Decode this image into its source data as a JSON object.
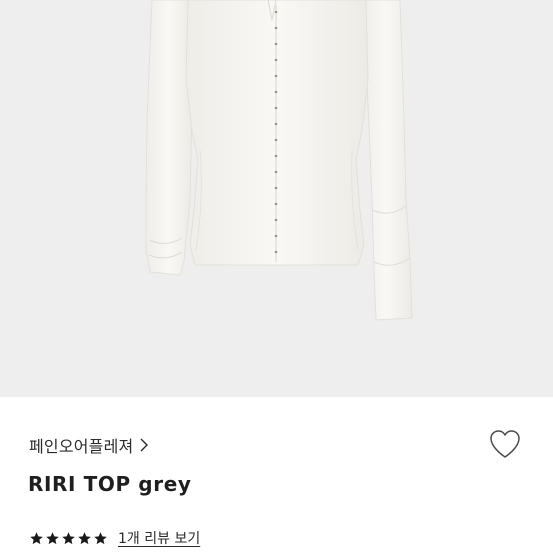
{
  "product": {
    "image_name": "product-image",
    "brand_label": "페인오어플레져",
    "title": "RIRI TOP grey",
    "rating": 5,
    "rating_max": 5,
    "review_link": "1개 리뷰 보기"
  },
  "icons": {
    "brand_chevron": "chevron-right-icon",
    "wishlist": "heart-outline-icon",
    "star": "star-filled-icon"
  },
  "colors": {
    "image_background": "#eeeeee",
    "garment": "#f7f6f3",
    "star": "#1a1a1a",
    "text": "#2b2b2b"
  }
}
